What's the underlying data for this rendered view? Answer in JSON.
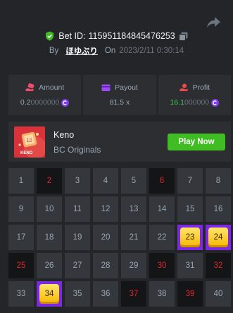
{
  "bet": {
    "label": "Bet ID:",
    "id": "115951184845476253"
  },
  "byline": {
    "by_label": "By",
    "user": "ほゆぶり",
    "on_label": "On",
    "date": "2023/2/11 0:30:14"
  },
  "stats": {
    "amount": {
      "label": "Amount",
      "value_main": "0.2",
      "value_dim": "0000000"
    },
    "payout": {
      "label": "Payout",
      "value": "81.5 x"
    },
    "profit": {
      "label": "Profit",
      "value_main": "16.1",
      "value_dim": "000000"
    }
  },
  "game": {
    "name": "Keno",
    "provider": "BC Originals",
    "play_label": "Play Now",
    "thumb_badge": "12",
    "thumb_caption": "KENO"
  },
  "keno": {
    "cells": [
      {
        "n": "1",
        "state": "idle"
      },
      {
        "n": "2",
        "state": "miss"
      },
      {
        "n": "3",
        "state": "idle"
      },
      {
        "n": "4",
        "state": "idle"
      },
      {
        "n": "5",
        "state": "idle"
      },
      {
        "n": "6",
        "state": "miss"
      },
      {
        "n": "7",
        "state": "idle"
      },
      {
        "n": "8",
        "state": "idle"
      },
      {
        "n": "9",
        "state": "idle"
      },
      {
        "n": "10",
        "state": "idle"
      },
      {
        "n": "11",
        "state": "idle"
      },
      {
        "n": "12",
        "state": "idle"
      },
      {
        "n": "13",
        "state": "idle"
      },
      {
        "n": "14",
        "state": "idle"
      },
      {
        "n": "15",
        "state": "idle"
      },
      {
        "n": "16",
        "state": "idle"
      },
      {
        "n": "17",
        "state": "idle"
      },
      {
        "n": "18",
        "state": "idle"
      },
      {
        "n": "19",
        "state": "idle"
      },
      {
        "n": "20",
        "state": "idle"
      },
      {
        "n": "21",
        "state": "idle"
      },
      {
        "n": "22",
        "state": "idle"
      },
      {
        "n": "23",
        "state": "hit"
      },
      {
        "n": "24",
        "state": "hit"
      },
      {
        "n": "25",
        "state": "miss"
      },
      {
        "n": "26",
        "state": "idle"
      },
      {
        "n": "27",
        "state": "idle"
      },
      {
        "n": "28",
        "state": "idle"
      },
      {
        "n": "29",
        "state": "idle"
      },
      {
        "n": "30",
        "state": "miss"
      },
      {
        "n": "31",
        "state": "idle"
      },
      {
        "n": "32",
        "state": "miss"
      },
      {
        "n": "33",
        "state": "idle"
      },
      {
        "n": "34",
        "state": "hit"
      },
      {
        "n": "35",
        "state": "idle"
      },
      {
        "n": "36",
        "state": "idle"
      },
      {
        "n": "37",
        "state": "miss"
      },
      {
        "n": "38",
        "state": "idle"
      },
      {
        "n": "39",
        "state": "miss"
      },
      {
        "n": "40",
        "state": "idle"
      }
    ]
  },
  "colors": {
    "background": "#232528",
    "panel": "#2c2e32",
    "cell": "#34373b",
    "miss_cell": "#141517",
    "miss_text": "#e2242d",
    "hit_border": "#7c2ae0",
    "gem": "#f5b800",
    "play_button": "#3fbd23",
    "profit_text": "#46c24e",
    "coin": "#7d3cf0"
  },
  "icons": {
    "share": "share-arrow-icon",
    "verified": "shield-check-icon",
    "copy": "copy-icon",
    "amount": "money-hand-icon",
    "payout": "wallet-icon",
    "profit": "profit-hand-icon",
    "coin": "coin-c-icon"
  }
}
